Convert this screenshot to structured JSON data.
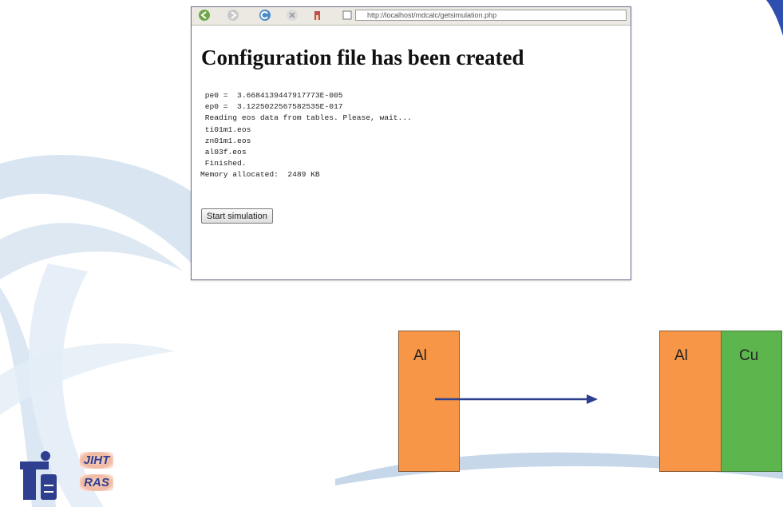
{
  "browser": {
    "address": "http://localhost/mdcalc/getsimulation.php",
    "page_title": "Configuration file has been created",
    "console_lines": [
      " pe0 =  3.6684139447917773E-005",
      " ep0 =  3.1225022567582535E-017",
      " Reading eos data from tables. Please, wait...",
      " ti01m1.eos",
      " zn01m1.eos",
      " al03f.eos",
      " Finished.",
      "Memory allocated:  2489 KB"
    ],
    "start_button_label": "Start simulation"
  },
  "diagram": {
    "left_block_label": "Al",
    "right_block_left_label": "Al",
    "right_block_right_label": "Cu"
  },
  "colors": {
    "aluminum": "#f79646",
    "copper": "#5db54e",
    "arrow": "#2e3f8f"
  },
  "logo": {
    "line1": "JIHT",
    "line2": "RAS"
  }
}
